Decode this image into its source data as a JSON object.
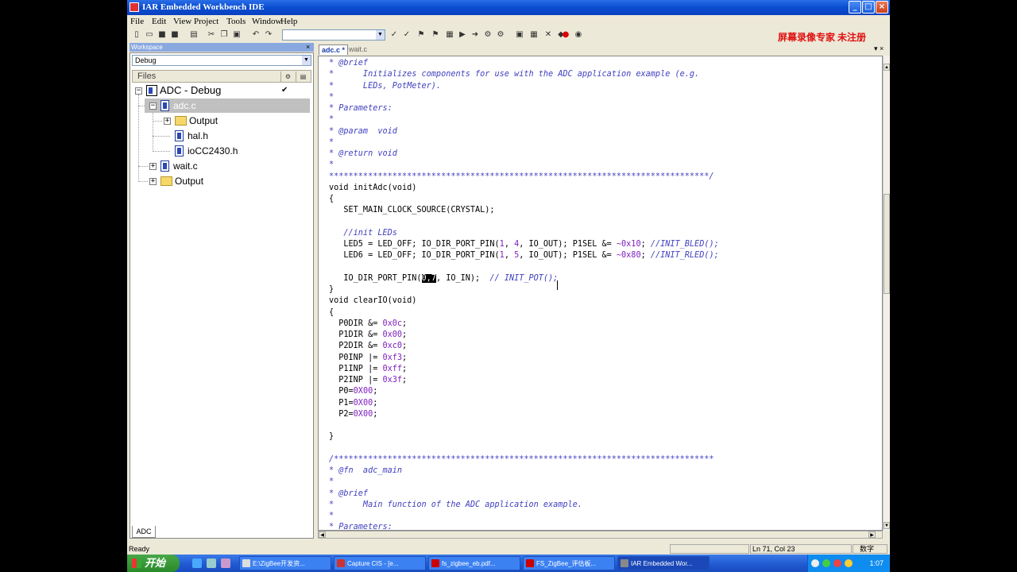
{
  "window": {
    "title": "IAR Embedded Workbench IDE",
    "watermark": "屏幕录像专家 未注册",
    "controls": {
      "minimize": "_",
      "maximize": "□",
      "close": "×"
    }
  },
  "menu": [
    "File",
    "Edit",
    "View",
    "Project",
    "Tools",
    "Window",
    "Help"
  ],
  "workspace": {
    "panel_title": "Workspace",
    "config": "Debug",
    "files_header": "Files",
    "tree": [
      {
        "label": "ADC - Debug",
        "check": "✔"
      },
      {
        "label": "adc.c"
      },
      {
        "label": "Output"
      },
      {
        "label": "hal.h"
      },
      {
        "label": "ioCC2430.h"
      },
      {
        "label": "wait.c"
      },
      {
        "label": "Output"
      }
    ],
    "bottom_tab": "ADC"
  },
  "editor": {
    "tabs": [
      "adc.c *",
      "wait.c"
    ],
    "tab_controls": "▾ ×",
    "code_lines": [
      "* @brief",
      "*      Initializes components for use with the ADC application example (e.g.",
      "*      LEDs, PotMeter).",
      "*",
      "* Parameters:",
      "*",
      "* @param  void",
      "*",
      "* @return void",
      "*",
      "******************************************************************************/",
      "void initAdc(void)",
      "{",
      "   SET_MAIN_CLOCK_SOURCE(CRYSTAL);",
      "",
      "   //init LEDs",
      "   LED5 = LED_OFF; IO_DIR_PORT_PIN(1, 4, IO_OUT); P1SEL &= ~0x10; //INIT_BLED();",
      "   LED6 = LED_OFF; IO_DIR_PORT_PIN(1, 5, IO_OUT); P1SEL &= ~0x80; //INIT_RLED();",
      "",
      "   IO_DIR_PORT_PIN(0,7, IO_IN);  // INIT_POT();",
      "}",
      "void clearIO(void)",
      "{",
      "  P0DIR &= 0x0c;",
      "  P1DIR &= 0x00;",
      "  P2DIR &= 0xc0;",
      "  P0INP |= 0xf3;",
      "  P1INP |= 0xff;",
      "  P2INP |= 0x3f;",
      "  P0=0X00;",
      "  P1=0X00;",
      "  P2=0X00;",
      "",
      "}",
      "",
      "/******************************************************************************",
      "* @fn  adc_main",
      "*",
      "* @brief",
      "*      Main function of the ADC application example.",
      "*",
      "* Parameters:",
      "*"
    ]
  },
  "status": {
    "left": "Ready",
    "position": "Ln 71, Col 23",
    "mode": "数字"
  },
  "taskbar": {
    "start": "开始",
    "tasks": [
      "E:\\ZigBee开发资...",
      "Capture CIS - [e...",
      "fs_zigbee_eb.pdf...",
      "FS_ZigBee_评估板...",
      "IAR Embedded Wor..."
    ],
    "clock": "1:07"
  }
}
